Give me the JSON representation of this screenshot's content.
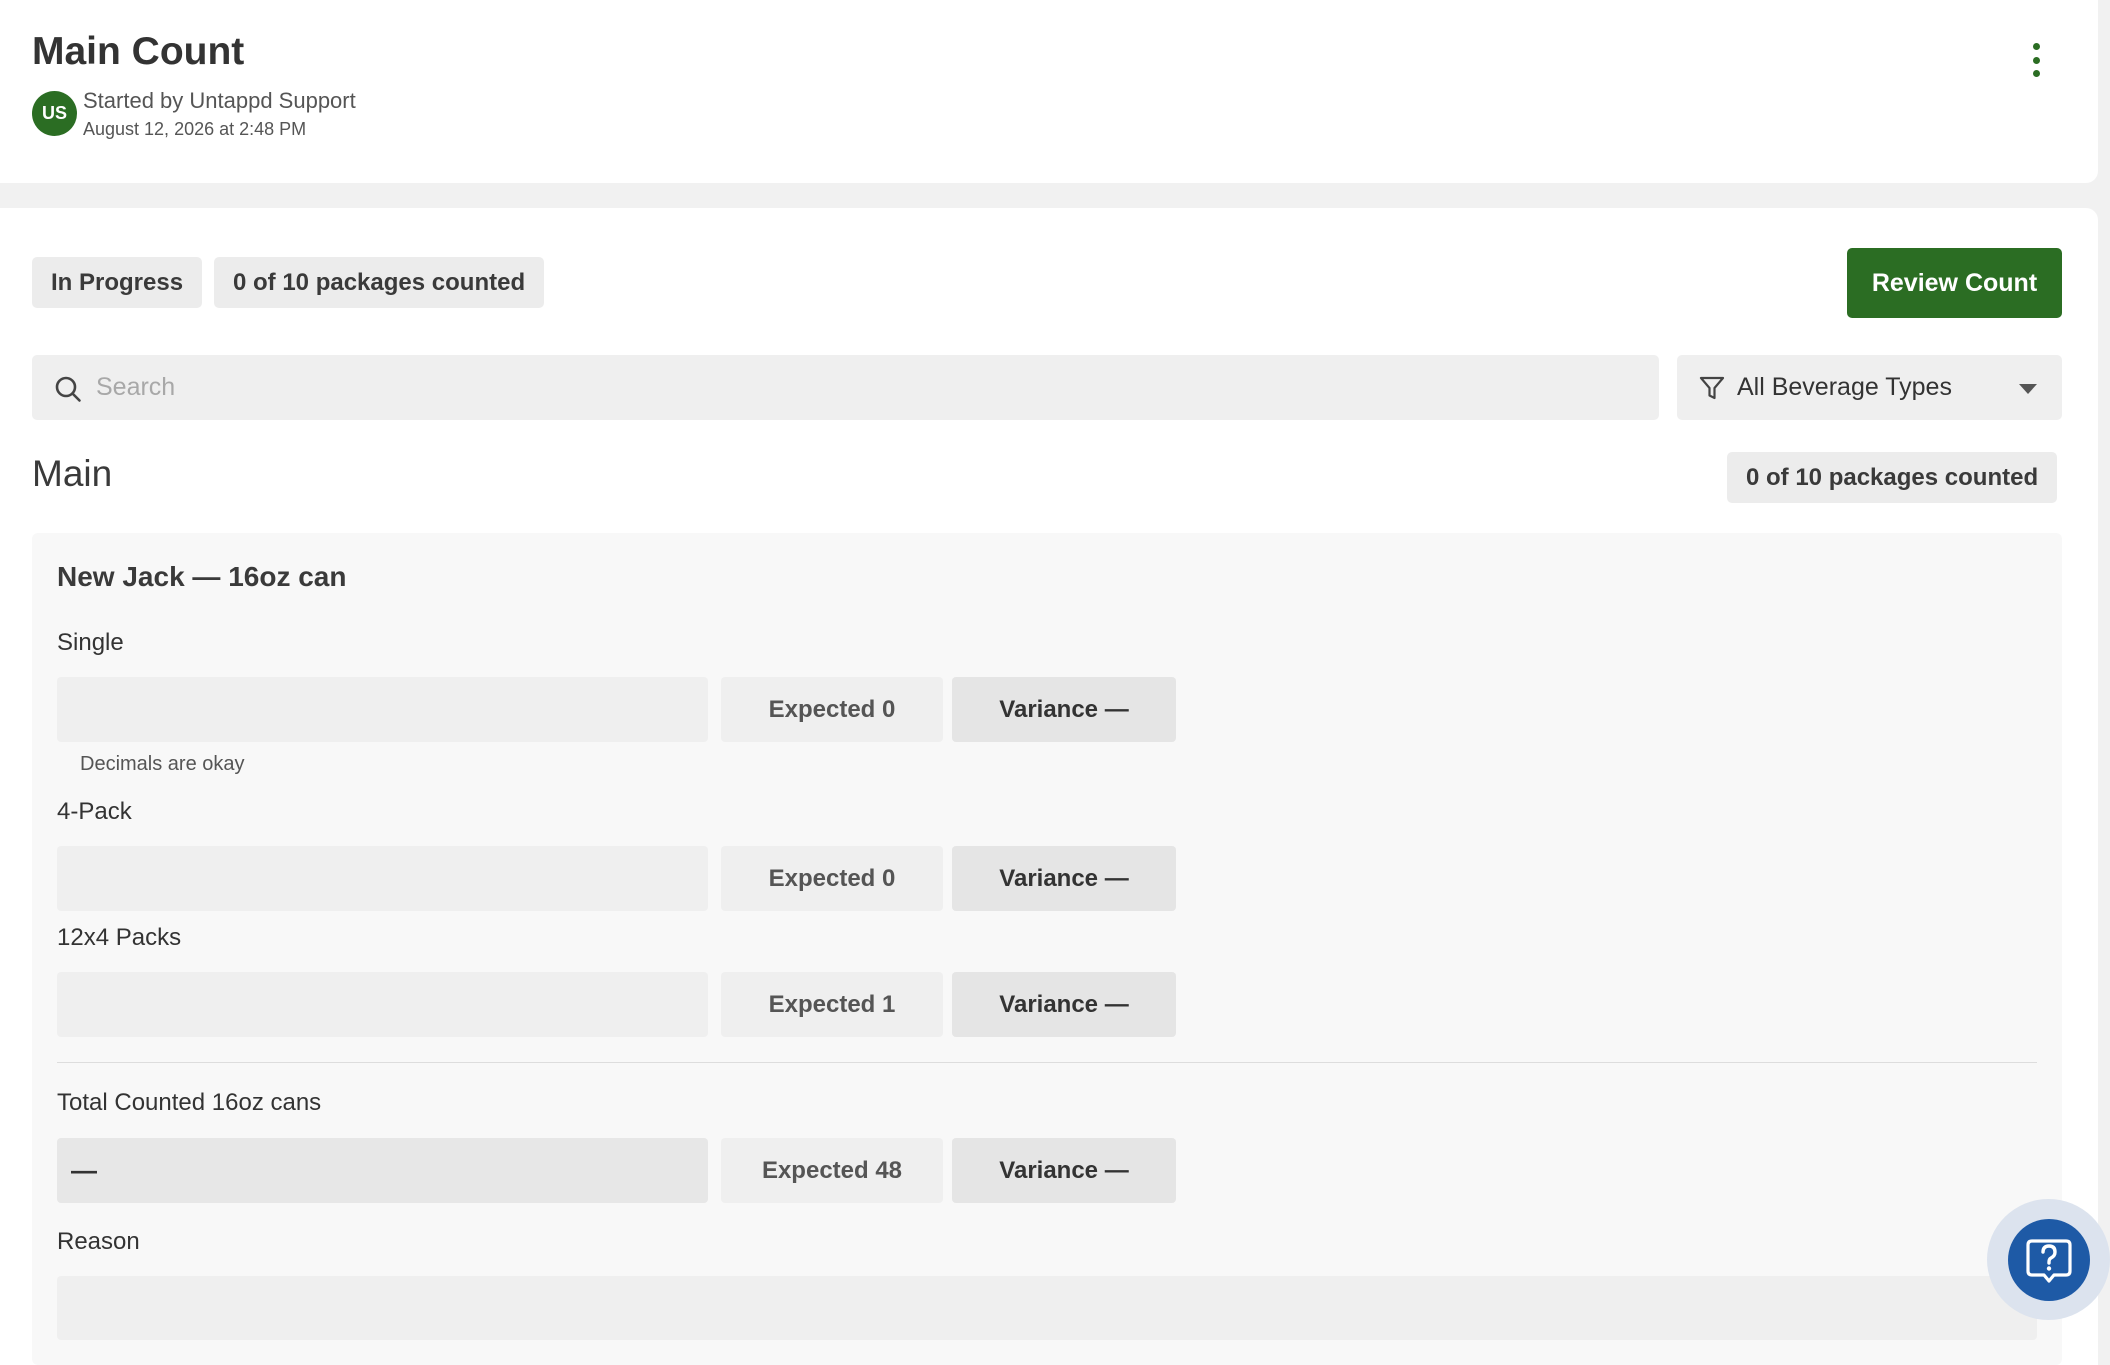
{
  "header": {
    "title": "Main Count",
    "avatar_initials": "US",
    "started_by": "Started by Untappd Support",
    "started_at": "August 12, 2026 at 2:48 PM"
  },
  "status": {
    "state": "In Progress",
    "progress": "0 of 10 packages counted",
    "review_button": "Review Count"
  },
  "search": {
    "placeholder": "Search"
  },
  "filter": {
    "label": "All Beverage Types"
  },
  "section": {
    "title": "Main",
    "progress": "0 of 10 packages counted"
  },
  "product": {
    "title": "New Jack — 16oz can",
    "packages": [
      {
        "label": "Single",
        "expected": "Expected 0",
        "variance": "Variance —",
        "hint": "Decimals are okay"
      },
      {
        "label": "4-Pack",
        "expected": "Expected 0",
        "variance": "Variance —"
      },
      {
        "label": "12x4 Packs",
        "expected": "Expected 1",
        "variance": "Variance —"
      }
    ],
    "total": {
      "label": "Total Counted 16oz cans",
      "value": "—",
      "expected": "Expected 48",
      "variance": "Variance —"
    },
    "reason_label": "Reason"
  },
  "colors": {
    "brand_green": "#2b6d23",
    "help_blue": "#1e5aa6"
  },
  "icons": [
    "kebab-menu-icon",
    "search-icon",
    "filter-icon",
    "caret-down-icon",
    "help-icon"
  ]
}
